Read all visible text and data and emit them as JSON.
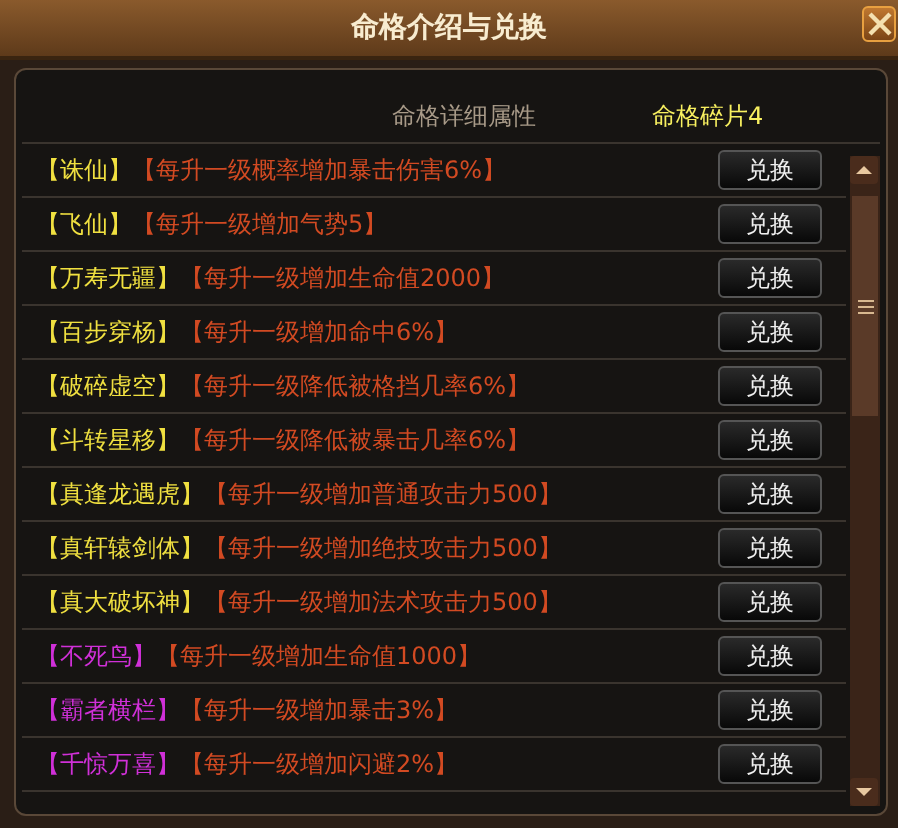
{
  "window": {
    "title": "命格介绍与兑换"
  },
  "header": {
    "column_title": "命格详细属性",
    "fragments": "命格碎片4"
  },
  "rows": [
    {
      "name": "【诛仙】",
      "color": "#f0e040",
      "effect": "【每升一级概率增加暴击伤害6%】",
      "button": "兑换"
    },
    {
      "name": "【飞仙】",
      "color": "#f0e040",
      "effect": "【每升一级增加气势5】",
      "button": "兑换"
    },
    {
      "name": "【万寿无疆】",
      "color": "#f0e040",
      "effect": "【每升一级增加生命值2000】",
      "button": "兑换"
    },
    {
      "name": "【百步穿杨】",
      "color": "#f0e040",
      "effect": "【每升一级增加命中6%】",
      "button": "兑换"
    },
    {
      "name": "【破碎虚空】",
      "color": "#f0e040",
      "effect": "【每升一级降低被格挡几率6%】",
      "button": "兑换"
    },
    {
      "name": "【斗转星移】",
      "color": "#f0e040",
      "effect": "【每升一级降低被暴击几率6%】",
      "button": "兑换"
    },
    {
      "name": "【真逢龙遇虎】",
      "color": "#f0e040",
      "effect": "【每升一级增加普通攻击力500】",
      "button": "兑换"
    },
    {
      "name": "【真轩辕剑体】",
      "color": "#f0e040",
      "effect": "【每升一级增加绝技攻击力500】",
      "button": "兑换"
    },
    {
      "name": "【真大破坏神】",
      "color": "#f0e040",
      "effect": "【每升一级增加法术攻击力500】",
      "button": "兑换"
    },
    {
      "name": "【不死鸟】",
      "color": "#d030d8",
      "effect": "【每升一级增加生命值1000】",
      "button": "兑换"
    },
    {
      "name": "【霸者横栏】",
      "color": "#d030d8",
      "effect": "【每升一级增加暴击3%】",
      "button": "兑换"
    },
    {
      "name": "【千惊万喜】",
      "color": "#d030d8",
      "effect": "【每升一级增加闪避2%】",
      "button": "兑换"
    }
  ]
}
